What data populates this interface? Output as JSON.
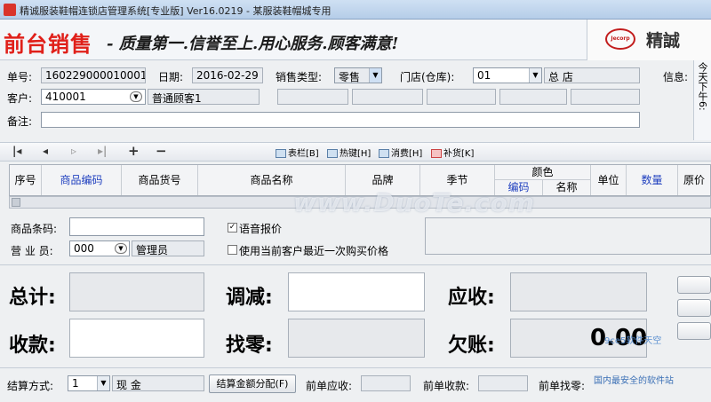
{
  "window": {
    "title": "精诚服装鞋帽连锁店管理系统[专业版] Ver16.0219 - 某服装鞋帽城专用"
  },
  "banner": {
    "brand": "前台销售",
    "slogan": "- 质量第一.信誉至上.用心服务.顾客满意!",
    "logo_mark": "Jecorp",
    "logo_text": "精誠"
  },
  "form": {
    "order_no_label": "单号:",
    "order_no": "160229000010001",
    "date_label": "日期:",
    "date": "2016-02-29",
    "sale_type_label": "销售类型:",
    "sale_type": "零售",
    "store_label": "门店(仓库):",
    "store_code": "01",
    "store_name": "总  店",
    "info_label": "信息:",
    "customer_label": "客户:",
    "customer_code": "410001",
    "customer_name": "普通顾客1",
    "note_label": "备注:",
    "note": ""
  },
  "sidebar_info": "今天下午6:",
  "toolbar": {
    "first": "|◂",
    "prev": "◂",
    "next": "▹",
    "last": "▸|",
    "add": "+",
    "remove": "−",
    "columns": "表栏[B]",
    "hotkeys": "热键[H]",
    "consume": "消费[H]",
    "restock": "补货[K]"
  },
  "grid": {
    "headers": [
      "序号",
      "商品编码",
      "商品货号",
      "商品名称",
      "品牌",
      "季节",
      "颜色",
      "单位",
      "数量",
      "原价"
    ],
    "color_sub": [
      "编码",
      "名称"
    ]
  },
  "entry": {
    "barcode_label": "商品条码:",
    "barcode": "",
    "clerk_label": "营 业 员:",
    "clerk_code": "000",
    "clerk_name": "管理员",
    "voice_label": "语音报价",
    "voice_checked": true,
    "last_price_label": "使用当前客户最近一次购买价格",
    "last_price_checked": false
  },
  "totals": {
    "total_label": "总计:",
    "adjust_label": "调减:",
    "receivable_label": "应收:",
    "received_label": "收款:",
    "change_label": "找零:",
    "owed_label": "欠账:",
    "owed_value": "0.00"
  },
  "footer": {
    "settle_label": "结算方式:",
    "settle_code": "1",
    "settle_name": "现  金",
    "split_button": "结算金额分配(F)",
    "prev_receivable_label": "前单应收:",
    "prev_received_label": "前单收款:",
    "prev_change_label": "前单找零:"
  },
  "watermarks": {
    "center": "www.DuoTe.com",
    "corner1": "9ce5软件天空",
    "corner2": "国内最安全的软件站"
  }
}
